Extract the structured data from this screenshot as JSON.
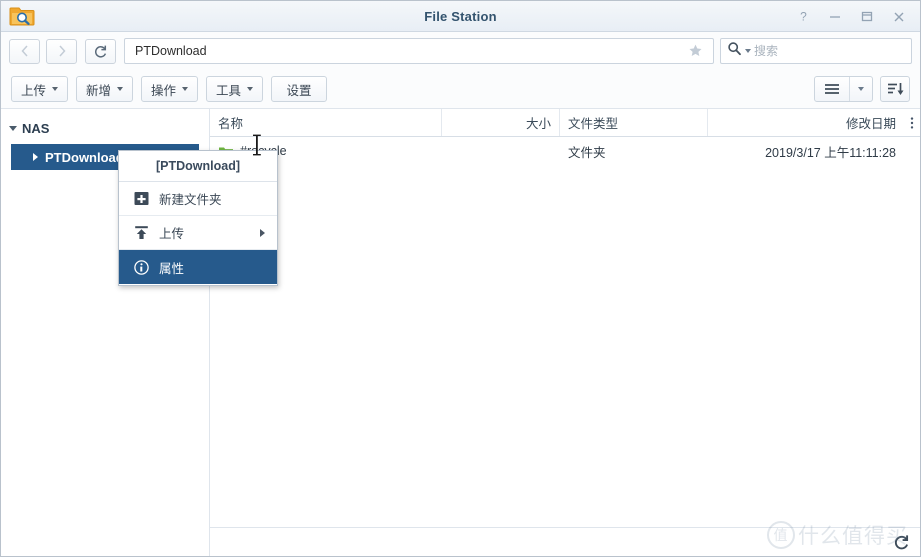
{
  "window": {
    "title": "File Station",
    "app_icon": "folder-search-icon",
    "controls": [
      {
        "name": "help-button",
        "glyph": "?"
      },
      {
        "name": "minimize-button",
        "glyph": "–"
      },
      {
        "name": "maximize-button",
        "glyph": "□"
      },
      {
        "name": "close-button",
        "glyph": "✕"
      }
    ]
  },
  "addressbar": {
    "back_icon": "chevron-left-icon",
    "forward_icon": "chevron-right-icon",
    "refresh_icon": "refresh-icon",
    "path_value": "PTDownload",
    "favorite_icon": "star-icon",
    "search": {
      "icon": "search-icon",
      "placeholder": "搜索",
      "value": ""
    }
  },
  "toolbar": {
    "buttons": [
      {
        "label": "上传",
        "has_caret": true,
        "name": "upload-button"
      },
      {
        "label": "新增",
        "has_caret": true,
        "name": "create-button"
      },
      {
        "label": "操作",
        "has_caret": true,
        "name": "action-button"
      },
      {
        "label": "工具",
        "has_caret": true,
        "name": "tools-button"
      },
      {
        "label": "设置",
        "has_caret": false,
        "name": "settings-button"
      }
    ],
    "view_button_icon": "list-view-icon",
    "view_caret_icon": "chevron-down-icon",
    "sort_button_icon": "sort-descending-icon"
  },
  "sidebar": {
    "root": {
      "label": "NAS",
      "expanded": true
    },
    "items": [
      {
        "label": "PTDownload",
        "selected": true,
        "expanded": false
      }
    ]
  },
  "filelist": {
    "columns": [
      {
        "key": "name",
        "label": "名称"
      },
      {
        "key": "size",
        "label": "大小"
      },
      {
        "key": "type",
        "label": "文件类型"
      },
      {
        "key": "date",
        "label": "修改日期"
      }
    ],
    "column_options_icon": "more-vertical-icon",
    "rows": [
      {
        "icon": "folder-icon",
        "name": "#recycle",
        "size": "",
        "type": "文件夹",
        "date": "2019/3/17 上午11:11:28"
      }
    ]
  },
  "statusbar": {
    "refresh_icon": "refresh-icon",
    "text": ""
  },
  "context_menu": {
    "title": "[PTDownload]",
    "items": [
      {
        "label": "新建文件夹",
        "icon": "new-folder-icon",
        "selected": false,
        "submenu": false
      },
      {
        "label": "上传",
        "icon": "upload-icon",
        "selected": false,
        "submenu": true
      },
      {
        "label": "属性",
        "icon": "info-icon",
        "selected": true,
        "submenu": false
      }
    ]
  },
  "watermark": {
    "badge": "值",
    "text": "什么值得买"
  },
  "colors": {
    "accent": "#265a8c",
    "title_text": "#33536e",
    "folder_green": "#6fb542",
    "folder_orange": "#f0a830"
  }
}
